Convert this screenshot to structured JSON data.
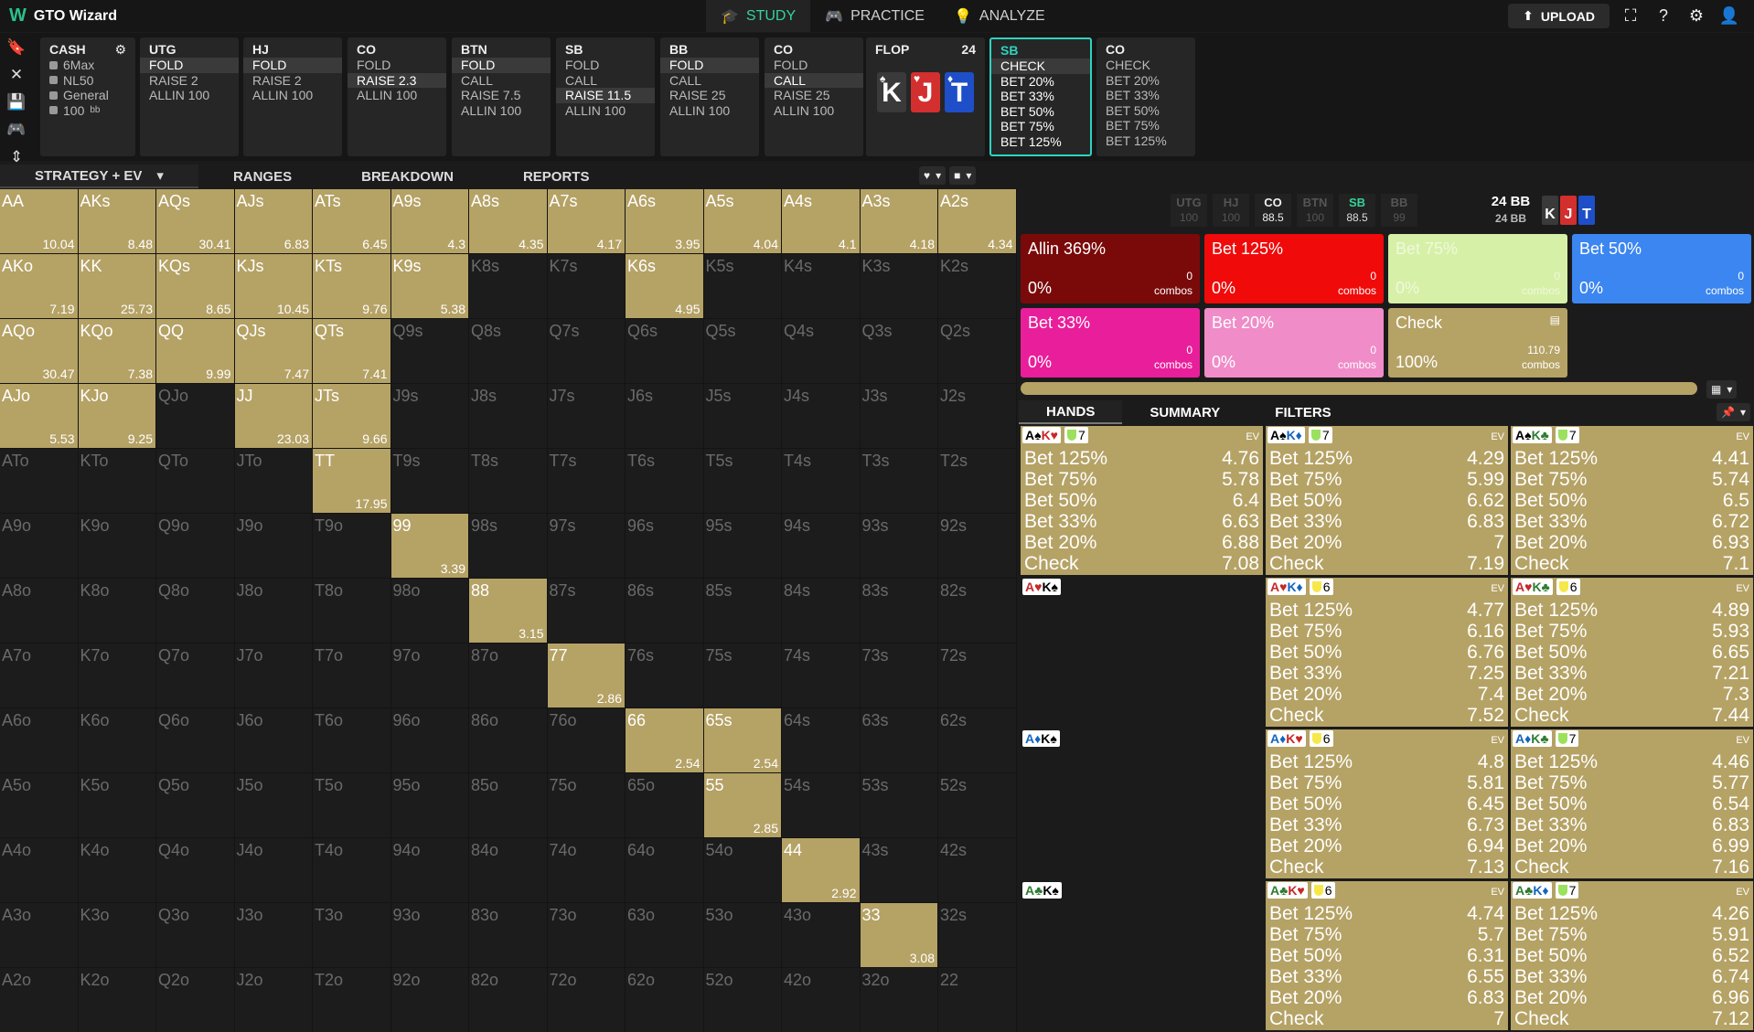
{
  "app": {
    "title": "GTO Wizard",
    "nav": [
      {
        "label": "STUDY",
        "icon": "graduation-cap-icon",
        "active": true
      },
      {
        "label": "PRACTICE",
        "icon": "gamepad-icon"
      },
      {
        "label": "ANALYZE",
        "icon": "lightbulb-icon"
      }
    ],
    "upload": "UPLOAD"
  },
  "cash": {
    "title": "CASH",
    "rows": [
      "6Max",
      "NL50",
      "General",
      "100"
    ],
    "bb_unit": "bb"
  },
  "nodes": [
    {
      "name": "UTG",
      "options": [
        "FOLD",
        "RAISE 2",
        "ALLIN 100"
      ],
      "selected": 0
    },
    {
      "name": "HJ",
      "options": [
        "FOLD",
        "RAISE 2",
        "ALLIN 100"
      ],
      "selected": 0
    },
    {
      "name": "CO",
      "options": [
        "FOLD",
        "RAISE 2.3",
        "ALLIN 100"
      ],
      "selected": 1
    },
    {
      "name": "BTN",
      "options": [
        "FOLD",
        "CALL",
        "RAISE 7.5",
        "ALLIN 100"
      ],
      "selected": 0
    },
    {
      "name": "SB",
      "options": [
        "FOLD",
        "CALL",
        "RAISE 11.5",
        "ALLIN 100"
      ],
      "selected": 2
    },
    {
      "name": "BB",
      "options": [
        "FOLD",
        "CALL",
        "RAISE 25",
        "ALLIN 100"
      ],
      "selected": 0
    },
    {
      "name": "CO",
      "options": [
        "FOLD",
        "CALL",
        "RAISE 25",
        "ALLIN 100"
      ],
      "selected": 1
    }
  ],
  "flop": {
    "label": "FLOP",
    "pot": "24",
    "cards": [
      {
        "rank": "K",
        "suit": "♠",
        "color": "#3a3a3a"
      },
      {
        "rank": "J",
        "suit": "♥",
        "color": "#d32f2f"
      },
      {
        "rank": "T",
        "suit": "♦",
        "color": "#1e4fc8"
      }
    ]
  },
  "sb_node": {
    "name": "SB",
    "options": [
      "CHECK",
      "BET 20%",
      "BET 33%",
      "BET 50%",
      "BET 75%",
      "BET 125%"
    ]
  },
  "co_node": {
    "name": "CO",
    "options": [
      "CHECK",
      "BET 20%",
      "BET 33%",
      "BET 50%",
      "BET 75%",
      "BET 125%"
    ]
  },
  "tabs": [
    "STRATEGY + EV",
    "RANGES",
    "BREAKDOWN",
    "REPORTS"
  ],
  "matrix": [
    [
      [
        "AA",
        "10.04"
      ],
      [
        "AKs",
        "8.48"
      ],
      [
        "AQs",
        "30.41"
      ],
      [
        "AJs",
        "6.83"
      ],
      [
        "ATs",
        "6.45"
      ],
      [
        "A9s",
        "4.3"
      ],
      [
        "A8s",
        "4.35"
      ],
      [
        "A7s",
        "4.17"
      ],
      [
        "A6s",
        "3.95"
      ],
      [
        "A5s",
        "4.04"
      ],
      [
        "A4s",
        "4.1"
      ],
      [
        "A3s",
        "4.18"
      ],
      [
        "A2s",
        "4.34"
      ]
    ],
    [
      [
        "AKo",
        "7.19"
      ],
      [
        "KK",
        "25.73"
      ],
      [
        "KQs",
        "8.65"
      ],
      [
        "KJs",
        "10.45"
      ],
      [
        "KTs",
        "9.76"
      ],
      [
        "K9s",
        "5.38"
      ],
      [
        "K8s",
        ""
      ],
      [
        "K7s",
        ""
      ],
      [
        "K6s",
        "4.95"
      ],
      [
        "K5s",
        ""
      ],
      [
        "K4s",
        ""
      ],
      [
        "K3s",
        ""
      ],
      [
        "K2s",
        ""
      ]
    ],
    [
      [
        "AQo",
        "30.47"
      ],
      [
        "KQo",
        "7.38"
      ],
      [
        "QQ",
        "9.99"
      ],
      [
        "QJs",
        "7.47"
      ],
      [
        "QTs",
        "7.41"
      ],
      [
        "Q9s",
        ""
      ],
      [
        "Q8s",
        ""
      ],
      [
        "Q7s",
        ""
      ],
      [
        "Q6s",
        ""
      ],
      [
        "Q5s",
        ""
      ],
      [
        "Q4s",
        ""
      ],
      [
        "Q3s",
        ""
      ],
      [
        "Q2s",
        ""
      ]
    ],
    [
      [
        "AJo",
        "5.53"
      ],
      [
        "KJo",
        "9.25"
      ],
      [
        "QJo",
        ""
      ],
      [
        "JJ",
        "23.03"
      ],
      [
        "JTs",
        "9.66"
      ],
      [
        "J9s",
        ""
      ],
      [
        "J8s",
        ""
      ],
      [
        "J7s",
        ""
      ],
      [
        "J6s",
        ""
      ],
      [
        "J5s",
        ""
      ],
      [
        "J4s",
        ""
      ],
      [
        "J3s",
        ""
      ],
      [
        "J2s",
        ""
      ]
    ],
    [
      [
        "ATo",
        ""
      ],
      [
        "KTo",
        ""
      ],
      [
        "QTo",
        ""
      ],
      [
        "JTo",
        ""
      ],
      [
        "TT",
        "17.95"
      ],
      [
        "T9s",
        ""
      ],
      [
        "T8s",
        ""
      ],
      [
        "T7s",
        ""
      ],
      [
        "T6s",
        ""
      ],
      [
        "T5s",
        ""
      ],
      [
        "T4s",
        ""
      ],
      [
        "T3s",
        ""
      ],
      [
        "T2s",
        ""
      ]
    ],
    [
      [
        "A9o",
        ""
      ],
      [
        "K9o",
        ""
      ],
      [
        "Q9o",
        ""
      ],
      [
        "J9o",
        ""
      ],
      [
        "T9o",
        ""
      ],
      [
        "99",
        "3.39"
      ],
      [
        "98s",
        ""
      ],
      [
        "97s",
        ""
      ],
      [
        "96s",
        ""
      ],
      [
        "95s",
        ""
      ],
      [
        "94s",
        ""
      ],
      [
        "93s",
        ""
      ],
      [
        "92s",
        ""
      ]
    ],
    [
      [
        "A8o",
        ""
      ],
      [
        "K8o",
        ""
      ],
      [
        "Q8o",
        ""
      ],
      [
        "J8o",
        ""
      ],
      [
        "T8o",
        ""
      ],
      [
        "98o",
        ""
      ],
      [
        "88",
        "3.15"
      ],
      [
        "87s",
        ""
      ],
      [
        "86s",
        ""
      ],
      [
        "85s",
        ""
      ],
      [
        "84s",
        ""
      ],
      [
        "83s",
        ""
      ],
      [
        "82s",
        ""
      ]
    ],
    [
      [
        "A7o",
        ""
      ],
      [
        "K7o",
        ""
      ],
      [
        "Q7o",
        ""
      ],
      [
        "J7o",
        ""
      ],
      [
        "T7o",
        ""
      ],
      [
        "97o",
        ""
      ],
      [
        "87o",
        ""
      ],
      [
        "77",
        "2.86"
      ],
      [
        "76s",
        ""
      ],
      [
        "75s",
        ""
      ],
      [
        "74s",
        ""
      ],
      [
        "73s",
        ""
      ],
      [
        "72s",
        ""
      ]
    ],
    [
      [
        "A6o",
        ""
      ],
      [
        "K6o",
        ""
      ],
      [
        "Q6o",
        ""
      ],
      [
        "J6o",
        ""
      ],
      [
        "T6o",
        ""
      ],
      [
        "96o",
        ""
      ],
      [
        "86o",
        ""
      ],
      [
        "76o",
        ""
      ],
      [
        "66",
        "2.54"
      ],
      [
        "65s",
        "2.54"
      ],
      [
        "64s",
        ""
      ],
      [
        "63s",
        ""
      ],
      [
        "62s",
        ""
      ]
    ],
    [
      [
        "A5o",
        ""
      ],
      [
        "K5o",
        ""
      ],
      [
        "Q5o",
        ""
      ],
      [
        "J5o",
        ""
      ],
      [
        "T5o",
        ""
      ],
      [
        "95o",
        ""
      ],
      [
        "85o",
        ""
      ],
      [
        "75o",
        ""
      ],
      [
        "65o",
        ""
      ],
      [
        "55",
        "2.85"
      ],
      [
        "54s",
        ""
      ],
      [
        "53s",
        ""
      ],
      [
        "52s",
        ""
      ]
    ],
    [
      [
        "A4o",
        ""
      ],
      [
        "K4o",
        ""
      ],
      [
        "Q4o",
        ""
      ],
      [
        "J4o",
        ""
      ],
      [
        "T4o",
        ""
      ],
      [
        "94o",
        ""
      ],
      [
        "84o",
        ""
      ],
      [
        "74o",
        ""
      ],
      [
        "64o",
        ""
      ],
      [
        "54o",
        ""
      ],
      [
        "44",
        "2.92"
      ],
      [
        "43s",
        ""
      ],
      [
        "42s",
        ""
      ]
    ],
    [
      [
        "A3o",
        ""
      ],
      [
        "K3o",
        ""
      ],
      [
        "Q3o",
        ""
      ],
      [
        "J3o",
        ""
      ],
      [
        "T3o",
        ""
      ],
      [
        "93o",
        ""
      ],
      [
        "83o",
        ""
      ],
      [
        "73o",
        ""
      ],
      [
        "63o",
        ""
      ],
      [
        "53o",
        ""
      ],
      [
        "43o",
        ""
      ],
      [
        "33",
        "3.08"
      ],
      [
        "32s",
        ""
      ]
    ],
    [
      [
        "A2o",
        ""
      ],
      [
        "K2o",
        ""
      ],
      [
        "Q2o",
        ""
      ],
      [
        "J2o",
        ""
      ],
      [
        "T2o",
        ""
      ],
      [
        "92o",
        ""
      ],
      [
        "82o",
        ""
      ],
      [
        "72o",
        ""
      ],
      [
        "62o",
        ""
      ],
      [
        "52o",
        ""
      ],
      [
        "42o",
        ""
      ],
      [
        "32o",
        ""
      ],
      [
        "22",
        ""
      ]
    ]
  ],
  "positions": [
    {
      "name": "UTG",
      "stack": "100"
    },
    {
      "name": "HJ",
      "stack": "100"
    },
    {
      "name": "CO",
      "stack": "88.5"
    },
    {
      "name": "BTN",
      "stack": "100"
    },
    {
      "name": "SB",
      "stack": "88.5"
    },
    {
      "name": "BB",
      "stack": "99"
    }
  ],
  "pot": {
    "main": "24 BB",
    "sub": "24 BB"
  },
  "actions": [
    {
      "name": "Allin 369%",
      "pct": "0%",
      "combos": "0",
      "color": "#7a0a0a"
    },
    {
      "name": "Bet 125%",
      "pct": "0%",
      "combos": "0",
      "color": "#f00a0a"
    },
    {
      "name": "Bet 75%",
      "pct": "0%",
      "combos": "0",
      "color": "#d6f0a8"
    },
    {
      "name": "Bet 50%",
      "pct": "0%",
      "combos": "0",
      "color": "#3b86f0"
    },
    {
      "name": "Bet 33%",
      "pct": "0%",
      "combos": "0",
      "color": "#e91e9a"
    },
    {
      "name": "Bet 20%",
      "pct": "0%",
      "combos": "0",
      "color": "#f08cc8"
    },
    {
      "name": "Check",
      "pct": "100%",
      "combos": "110.79",
      "color": "#b5a265"
    }
  ],
  "combos_label": "combos",
  "hand_tabs": [
    "HANDS",
    "SUMMARY",
    "FILTERS"
  ],
  "ev_label": "EV",
  "hands": [
    {
      "c1": "A♠",
      "c2": "K♥",
      "tag": "7",
      "tagc": "#9be15d",
      "vals": [
        "4.76",
        "5.78",
        "6.4",
        "6.63",
        "6.88",
        "7.08"
      ]
    },
    {
      "c1": "A♠",
      "c2": "K♦",
      "tag": "7",
      "tagc": "#9be15d",
      "vals": [
        "4.29",
        "5.99",
        "6.62",
        "6.83",
        "7",
        "7.19"
      ]
    },
    {
      "c1": "A♠",
      "c2": "K♣",
      "tag": "7",
      "tagc": "#9be15d",
      "vals": [
        "4.41",
        "5.74",
        "6.5",
        "6.72",
        "6.93",
        "7.1"
      ]
    },
    {
      "c1": "A♥",
      "c2": "K♠",
      "empty": true
    },
    {
      "c1": "A♥",
      "c2": "K♦",
      "tag": "6",
      "tagc": "#f7e84a",
      "vals": [
        "4.77",
        "6.16",
        "6.76",
        "7.25",
        "7.4",
        "7.52"
      ]
    },
    {
      "c1": "A♥",
      "c2": "K♣",
      "tag": "6",
      "tagc": "#f7e84a",
      "vals": [
        "4.89",
        "5.93",
        "6.65",
        "7.21",
        "7.3",
        "7.44"
      ]
    },
    {
      "c1": "A♦",
      "c2": "K♠",
      "empty": true
    },
    {
      "c1": "A♦",
      "c2": "K♥",
      "tag": "6",
      "tagc": "#f7e84a",
      "vals": [
        "4.8",
        "5.81",
        "6.45",
        "6.73",
        "6.94",
        "7.13"
      ]
    },
    {
      "c1": "A♦",
      "c2": "K♣",
      "tag": "7",
      "tagc": "#9be15d",
      "vals": [
        "4.46",
        "5.77",
        "6.54",
        "6.83",
        "6.99",
        "7.16"
      ]
    },
    {
      "c1": "A♣",
      "c2": "K♠",
      "empty": true
    },
    {
      "c1": "A♣",
      "c2": "K♥",
      "tag": "6",
      "tagc": "#f7e84a",
      "vals": [
        "4.74",
        "5.7",
        "6.31",
        "6.55",
        "6.83",
        "7"
      ]
    },
    {
      "c1": "A♣",
      "c2": "K♦",
      "tag": "7",
      "tagc": "#9be15d",
      "vals": [
        "4.26",
        "5.91",
        "6.52",
        "6.74",
        "6.96",
        "7.12"
      ]
    }
  ],
  "hand_actions": [
    "Bet 125%",
    "Bet 75%",
    "Bet 50%",
    "Bet 33%",
    "Bet 20%",
    "Check"
  ]
}
